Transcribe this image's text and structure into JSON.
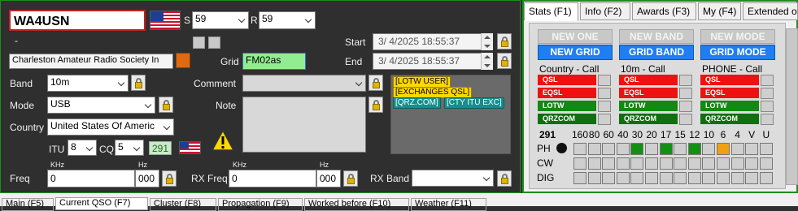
{
  "qso": {
    "callsign": "WA4USN",
    "s_label": "S",
    "s_value": "59",
    "r_label": "R",
    "r_value": "59",
    "dash": "-",
    "name": "Charleston Amateur Radio Society In",
    "start_label": "Start",
    "start_value": "3/  4/2025 18:55:37",
    "end_label": "End",
    "end_value": "3/  4/2025 18:55:37",
    "grid_label": "Grid",
    "grid_value": "FM02as",
    "band_label": "Band",
    "band_value": "10m",
    "mode_label": "Mode",
    "mode_value": "USB",
    "country_label": "Country",
    "country_value": "United States Of Americ",
    "itu_label": "ITU",
    "itu_value": "8",
    "cq_label": "CQ",
    "cq_value": "5",
    "dxcc_badge": "291",
    "comment_label": "Comment",
    "comment_value": "",
    "note_label": "Note",
    "tags": [
      "[LOTW USER]",
      "[EXCHANGES QSL]"
    ],
    "tags2": [
      "[QRZ.COM]",
      "[CTY ITU EXC]"
    ],
    "freq_label": "Freq",
    "khz_label": "KHz",
    "hz_label": "Hz",
    "freq_khz": "0",
    "freq_hz": "000",
    "rxfreq_label": "RX Freq",
    "rxfreq_khz": "0",
    "rxfreq_hz": "000",
    "rxband_label": "RX Band",
    "rxband_value": ""
  },
  "stats": {
    "tabs": [
      "Stats (F1)",
      "Info (F2)",
      "Awards (F3)",
      "My (F4)",
      "Extended o"
    ],
    "top_buttons": [
      "NEW ONE",
      "NEW BAND",
      "NEW MODE"
    ],
    "blue_buttons": [
      "NEW GRID",
      "GRID BAND",
      "GRID MODE"
    ],
    "columns": [
      {
        "header": "Country - Call",
        "rows": [
          "QSL",
          "EQSL",
          "LOTW",
          "QRZCOM"
        ]
      },
      {
        "header": "10m - Call",
        "rows": [
          "QSL",
          "EQSL",
          "LOTW",
          "QRZCOM"
        ]
      },
      {
        "header": "PHONE - Call",
        "rows": [
          "QSL",
          "EQSL",
          "LOTW",
          "QRZCOM"
        ]
      }
    ],
    "grid_count": "291",
    "bands": [
      "160",
      "80",
      "60",
      "40",
      "30",
      "20",
      "17",
      "15",
      "12",
      "10",
      "6",
      "4",
      "V",
      "U"
    ],
    "modes": [
      "PH",
      "CW",
      "DIG"
    ],
    "ph_status": [
      "",
      "",
      "",
      "",
      "green",
      "",
      "green",
      "",
      "green",
      "",
      "orange",
      "",
      "",
      ""
    ],
    "colors": {
      "red": "#ee1111",
      "green": "#138813",
      "orange": "#f0a010",
      "blue": "#1e7ef2"
    }
  },
  "bottom_tabs": [
    "Main (F5)",
    "Current QSO (F7)",
    "Cluster (F8)",
    "Propagation (F9)",
    "Worked before (F10)",
    "Weather (F11)"
  ]
}
